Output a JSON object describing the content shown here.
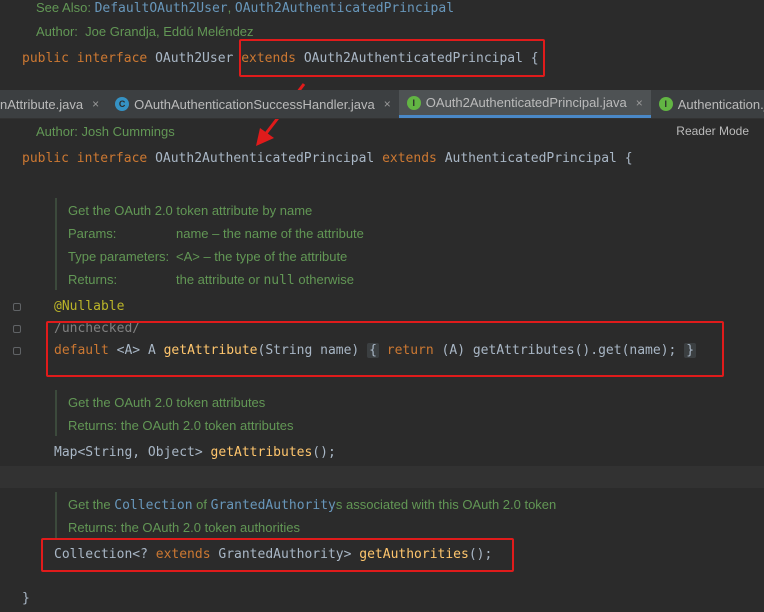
{
  "top_doc": {
    "see_also_label": "See Also:",
    "see_also_link1": "DefaultOAuth2User",
    "see_also_sep": ",",
    "see_also_link2": "OAuth2AuthenticatedPrincipal",
    "author_label": "Author:",
    "author_value": "Joe Grandja, Eddú Meléndez"
  },
  "top_decl": {
    "public": "public",
    "interface": "interface",
    "name": "OAuth2User",
    "extends": "extends",
    "parent": "OAuth2AuthenticatedPrincipal",
    "brace": "{"
  },
  "tabs": [
    {
      "label": "nAttribute.java",
      "icon": "",
      "icon_color": "",
      "active": false
    },
    {
      "label": "OAuthAuthenticationSuccessHandler.java",
      "icon": "C",
      "icon_color": "#3592c4",
      "active": false
    },
    {
      "label": "OAuth2AuthenticatedPrincipal.java",
      "icon": "I",
      "icon_color": "#62b543",
      "active": true
    },
    {
      "label": "Authentication.java",
      "icon": "I",
      "icon_color": "#62b543",
      "active": false
    }
  ],
  "tab_close_glyph": "×",
  "reader_mode": "Reader Mode",
  "main_doc": {
    "author_label": "Author:",
    "author_value": "Josh Cummings"
  },
  "main_decl": {
    "public": "public",
    "interface": "interface",
    "name": "OAuth2AuthenticatedPrincipal",
    "extends": "extends",
    "parent": "AuthenticatedPrincipal",
    "brace": "{"
  },
  "get_attribute_doc": {
    "summary": "Get the OAuth 2.0 token attribute by name",
    "params_label": "Params:",
    "params_value": "name – the name of the attribute",
    "type_params_label": "Type parameters:",
    "type_params_value": "<A> – the type of the attribute",
    "returns_label": "Returns:",
    "returns_value_pre": "the attribute or",
    "returns_value_code": "null",
    "returns_value_post": "otherwise"
  },
  "get_attribute_code": {
    "annotation": "@Nullable",
    "comment": "/unchecked/",
    "default": "default",
    "generic": "<A>",
    "ret_type": "A",
    "method": "getAttribute",
    "params": "(String name)",
    "body_open": "{",
    "return_kw": "return",
    "cast": "(A)",
    "body_call": "getAttributes().get(name);",
    "body_close": "}"
  },
  "get_attributes_doc": {
    "summary": "Get the OAuth 2.0 token attributes",
    "returns": "Returns: the OAuth 2.0 token attributes"
  },
  "get_attributes_code": {
    "ret_type": "Map<String, Object>",
    "method": "getAttributes",
    "tail": "();"
  },
  "get_authorities_doc": {
    "pre": "Get the",
    "link1": "Collection",
    "mid": "of",
    "link2": "GrantedAuthority",
    "post": "s associated with this OAuth 2.0 token",
    "returns": "Returns: the OAuth 2.0 token authorities"
  },
  "get_authorities_code": {
    "ret_type_pre": "Collection<?",
    "extends": "extends",
    "ret_type_post": "GrantedAuthority>",
    "method": "getAuthorities",
    "tail": "();"
  },
  "closing_brace": "}",
  "colors": {
    "background": "#2b2b2b",
    "keyword": "#cc7832",
    "method": "#ffc66d",
    "doc": "#629755",
    "annotation": "#bbb529",
    "link": "#6897bb",
    "highlight_box": "#e01b1b"
  }
}
